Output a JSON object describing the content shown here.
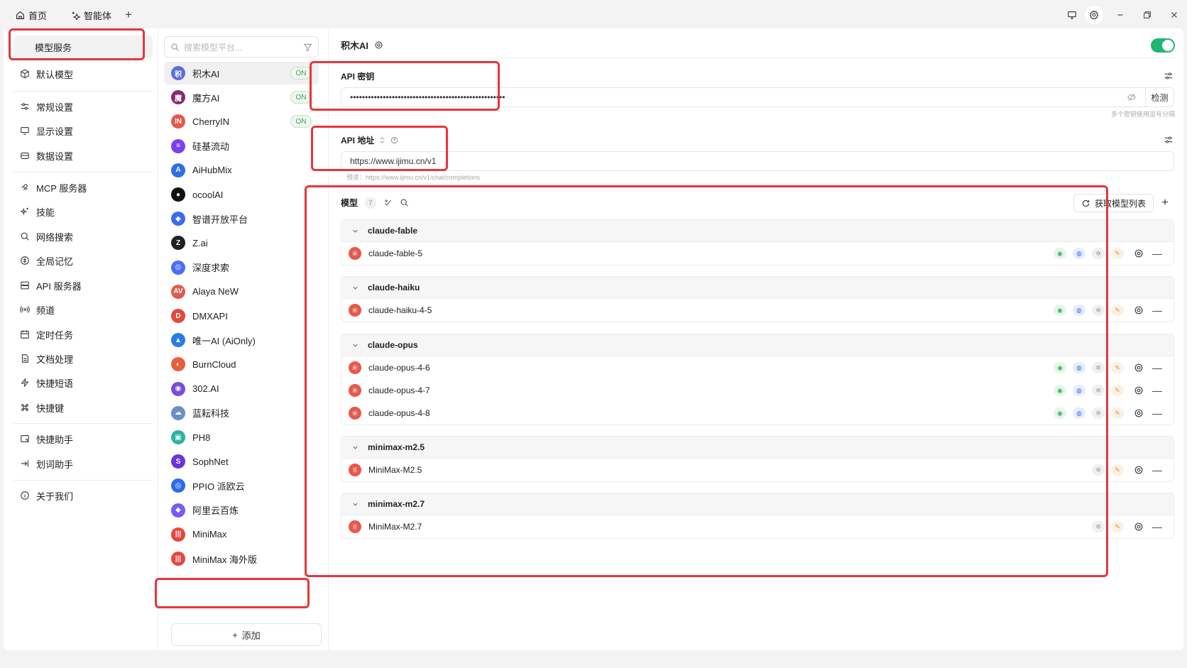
{
  "titlebar": {
    "tabs": [
      {
        "label": "首页",
        "icon": "home-icon"
      },
      {
        "label": "智能体",
        "icon": "sparkle-icon"
      }
    ],
    "new_tab_icon": "plus-icon",
    "window_buttons": [
      "monitor-icon",
      "settings-icon",
      "minimize-icon",
      "restore-icon",
      "close-icon"
    ]
  },
  "nav": {
    "items": [
      {
        "label": "模型服务",
        "icon": "cube-icon",
        "active": true
      },
      {
        "label": "默认模型",
        "icon": "cube-icon"
      },
      {
        "label": "常规设置",
        "icon": "sliders-icon"
      },
      {
        "label": "显示设置",
        "icon": "display-icon"
      },
      {
        "label": "数据设置",
        "icon": "database-icon"
      },
      {
        "label": "MCP 服务器",
        "icon": "mcp-icon"
      },
      {
        "label": "技能",
        "icon": "sparkles-icon"
      },
      {
        "label": "网络搜索",
        "icon": "search-icon"
      },
      {
        "label": "全局记忆",
        "icon": "memory-icon"
      },
      {
        "label": "API 服务器",
        "icon": "server-icon"
      },
      {
        "label": "频道",
        "icon": "radio-icon"
      },
      {
        "label": "定时任务",
        "icon": "calendar-icon"
      },
      {
        "label": "文档处理",
        "icon": "document-icon"
      },
      {
        "label": "快捷短语",
        "icon": "lightning-icon"
      },
      {
        "label": "快捷键",
        "icon": "command-icon"
      },
      {
        "label": "快捷助手",
        "icon": "assistant-icon"
      },
      {
        "label": "划词助手",
        "icon": "select-text-icon"
      },
      {
        "label": "关于我们",
        "icon": "info-icon"
      }
    ]
  },
  "providers": {
    "search_placeholder": "搜索模型平台...",
    "items": [
      {
        "name": "积木AI",
        "badge": "ON",
        "logo_text": "积",
        "color": "#5b6ee1"
      },
      {
        "name": "魔方AI",
        "badge": "ON",
        "logo_text": "魔",
        "color": "#8a2a6b"
      },
      {
        "name": "CherryIN",
        "badge": "ON",
        "logo_text": "IN",
        "color": "#e8574d"
      },
      {
        "name": "硅基流动",
        "logo_text": "≡",
        "color": "#7b3ff2"
      },
      {
        "name": "AiHubMix",
        "logo_text": "A",
        "color": "#2f6fe0"
      },
      {
        "name": "ocoolAI",
        "logo_text": "●",
        "color": "#111111"
      },
      {
        "name": "智谱开放平台",
        "logo_text": "◆",
        "color": "#3b6cf0"
      },
      {
        "name": "Z.ai",
        "logo_text": "Z",
        "color": "#222222"
      },
      {
        "name": "深度求索",
        "logo_text": "◎",
        "color": "#4d6bfe"
      },
      {
        "name": "Alaya NeW",
        "logo_text": "AV",
        "color": "#e25a4d"
      },
      {
        "name": "DMXAPI",
        "logo_text": "D",
        "color": "#e24a3b"
      },
      {
        "name": "唯一AI (AiOnly)",
        "logo_text": "▲",
        "color": "#2c7be5"
      },
      {
        "name": "BurnCloud",
        "logo_text": "◐",
        "color": "#e8603a"
      },
      {
        "name": "302.AI",
        "logo_text": "◉",
        "color": "#7c4ddb"
      },
      {
        "name": "蓝耘科技",
        "logo_text": "☁",
        "color": "#6b8fc4"
      },
      {
        "name": "PH8",
        "logo_text": "▣",
        "color": "#2bb5a0"
      },
      {
        "name": "SophNet",
        "logo_text": "S",
        "color": "#6a35d9"
      },
      {
        "name": "PPIO 派欧云",
        "logo_text": "◎",
        "color": "#2d6ce8"
      },
      {
        "name": "阿里云百炼",
        "logo_text": "◆",
        "color": "#7a5af8"
      },
      {
        "name": "MiniMax",
        "logo_text": "|||",
        "color": "#e8453c"
      },
      {
        "name": "MiniMax 海外版",
        "logo_text": "|||",
        "color": "#e8453c"
      }
    ],
    "add_label": "添加"
  },
  "detail": {
    "title": "积木AI",
    "enabled": true,
    "api_key": {
      "label": "API 密钥",
      "value": "••••••••••••••••••••••••••••••••••••••••••••••••••••",
      "check_label": "检测",
      "hint": "多个密钥使用逗号分隔"
    },
    "api_url": {
      "label": "API 地址",
      "value": "https://www.ijimu.cn/v1",
      "preview": "预览：https://www.ijimu.cn/v1/chat/completions"
    },
    "models": {
      "label": "模型",
      "count": "7",
      "fetch_label": "获取模型列表",
      "groups": [
        {
          "name": "claude-fable",
          "models": [
            "claude-fable-5"
          ]
        },
        {
          "name": "claude-haiku",
          "models": [
            "claude-haiku-4-5"
          ]
        },
        {
          "name": "claude-opus",
          "models": [
            "claude-opus-4-6",
            "claude-opus-4-7",
            "claude-opus-4-8"
          ]
        },
        {
          "name": "minimax-m2.5",
          "models": [
            "MiniMax-M2.5"
          ]
        },
        {
          "name": "minimax-m2.7",
          "models": [
            "MiniMax-M2.7"
          ]
        }
      ]
    }
  },
  "colors": {
    "annotation": "#e8353b",
    "toggle_on": "#22b573",
    "model_logo_claude": "#e9574b"
  }
}
